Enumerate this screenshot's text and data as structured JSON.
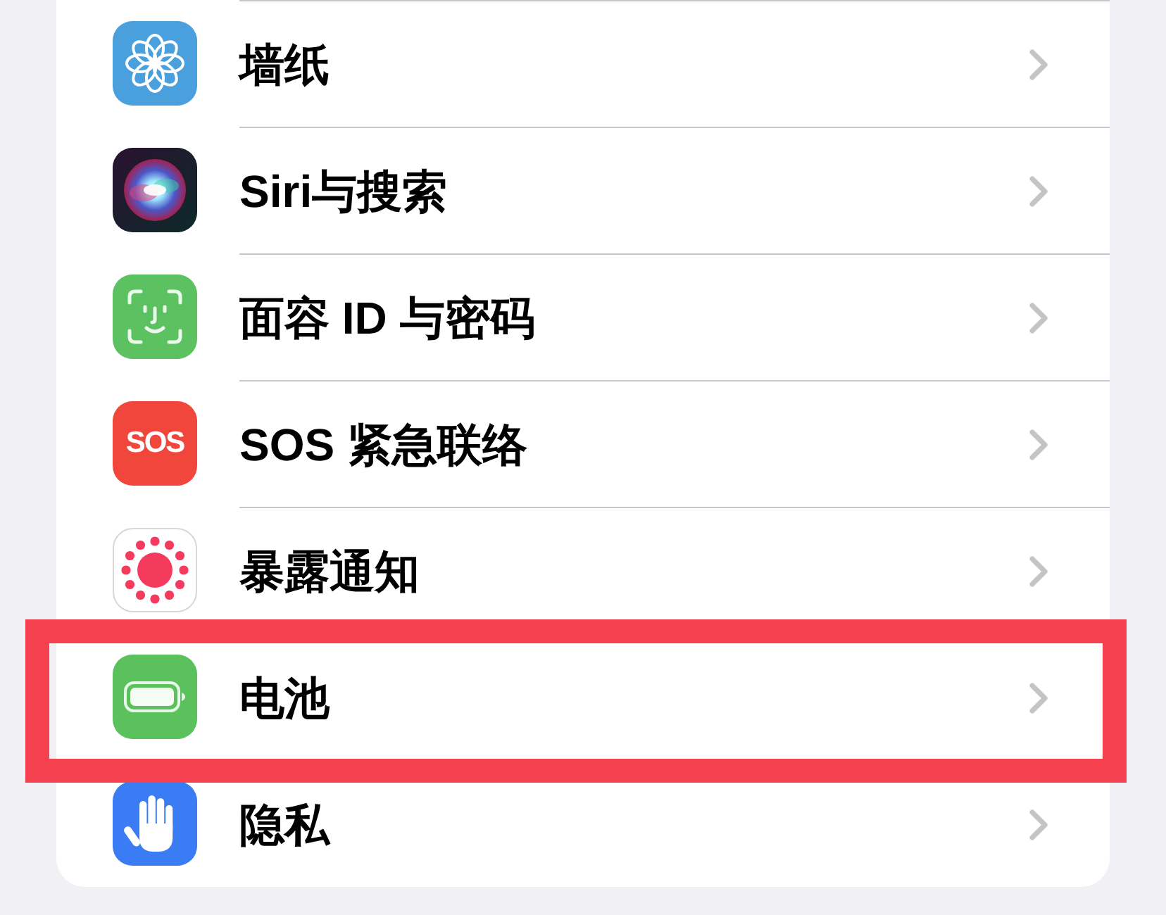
{
  "settings": {
    "items": [
      {
        "kind": "wallpaper",
        "label": "墙纸",
        "highlighted": false
      },
      {
        "kind": "siri",
        "label": "Siri与搜索",
        "highlighted": false
      },
      {
        "kind": "face-id",
        "label": "面容 ID 与密码",
        "highlighted": false
      },
      {
        "kind": "sos",
        "icon_text": "SOS",
        "label": "SOS 紧急联络",
        "highlighted": false
      },
      {
        "kind": "exposure",
        "label": "暴露通知",
        "highlighted": false
      },
      {
        "kind": "battery",
        "label": "电池",
        "highlighted": true
      },
      {
        "kind": "privacy",
        "label": "隐私",
        "highlighted": false
      }
    ]
  }
}
